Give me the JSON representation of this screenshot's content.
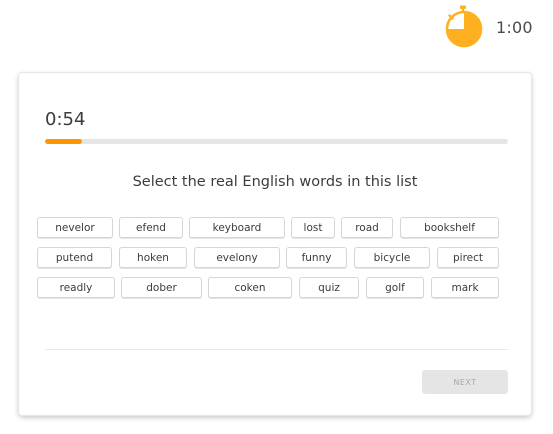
{
  "header": {
    "timer_icon": "stopwatch-icon",
    "total_time": "1:00"
  },
  "quiz": {
    "elapsed": "0:54",
    "progress": 0.08,
    "prompt": "Select the real English words in this list",
    "words": [
      "nevelor",
      "efend",
      "keyboard",
      "lost",
      "road",
      "bookshelf",
      "putend",
      "hoken",
      "evelony",
      "funny",
      "bicycle",
      "pirect",
      "readly",
      "dober",
      "coken",
      "quiz",
      "golf",
      "mark"
    ],
    "next_label": "NEXT"
  },
  "colors": {
    "accent": "#ff9600",
    "track": "#e5e5e5",
    "disabled_button": "#e5e5e5"
  }
}
